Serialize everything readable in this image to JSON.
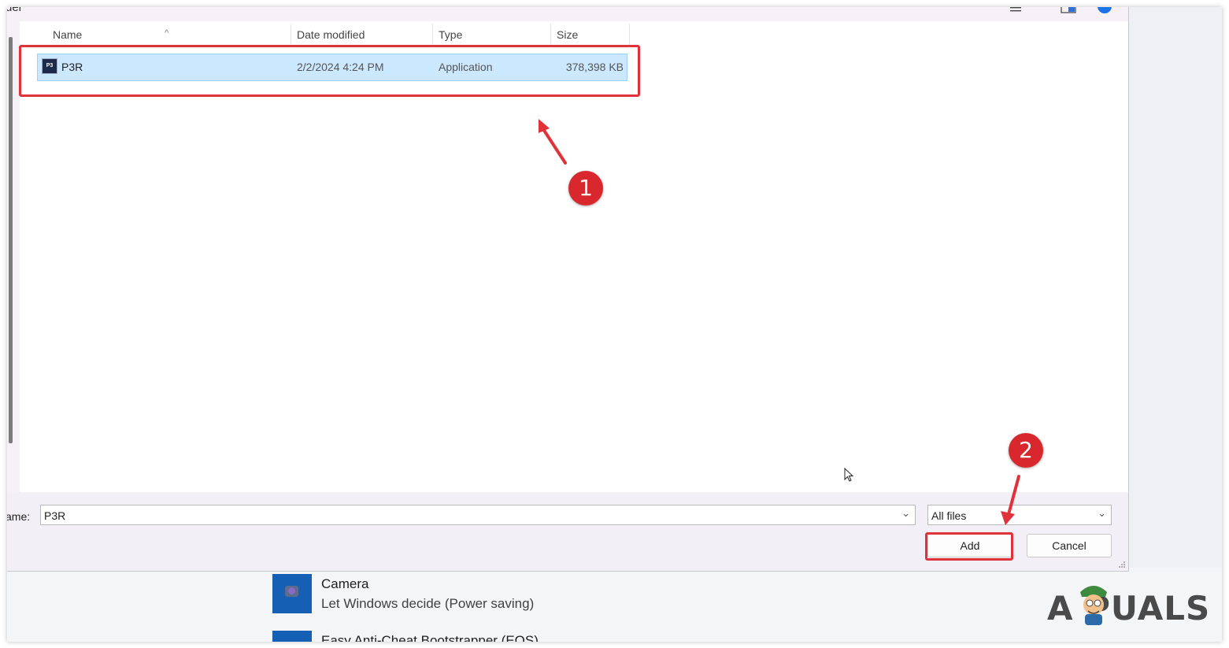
{
  "dialog": {
    "title_fragment": "der",
    "columns": [
      "Name",
      "Date modified",
      "Type",
      "Size"
    ],
    "files": [
      {
        "name": "P3R",
        "icon": "app-icon",
        "date": "2/2/2024 4:24 PM",
        "type": "Application",
        "size": "378,398 KB"
      }
    ],
    "filename_label": "ame:",
    "filename_value": "P3R",
    "filetype_value": "All files",
    "add_label": "Add",
    "cancel_label": "Cancel"
  },
  "background": {
    "items": [
      {
        "title": "Camera",
        "subtitle": "Let Windows decide (Power saving)",
        "icon": "camera-icon"
      },
      {
        "title": "Easy Anti-Cheat Bootstrapper (EOS)",
        "icon": "app-tile-icon"
      }
    ]
  },
  "annotations": {
    "step1": "1",
    "step2": "2",
    "color": "#d9272e"
  },
  "watermark": {
    "text": "A PUALS"
  }
}
